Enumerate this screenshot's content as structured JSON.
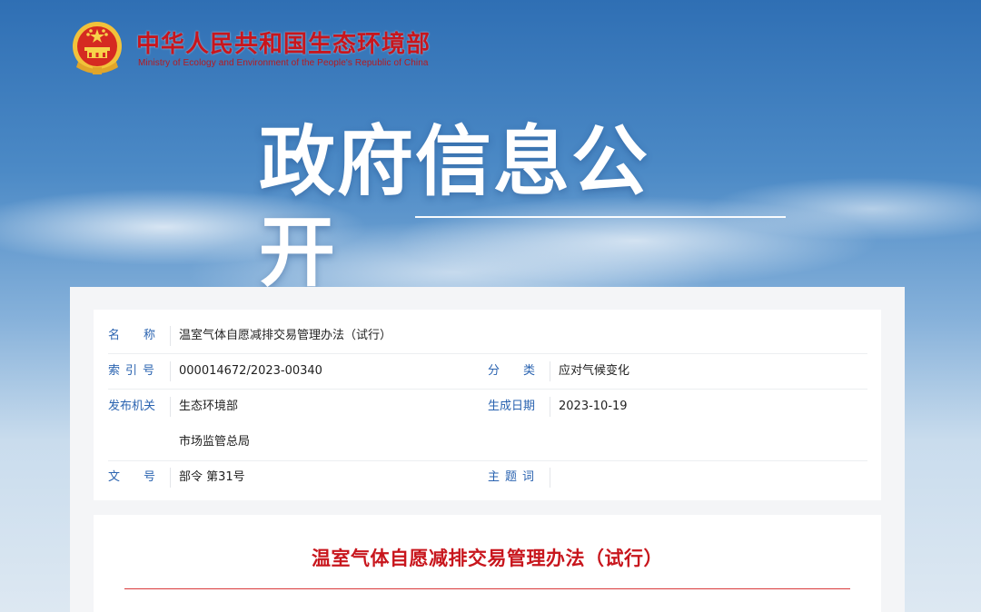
{
  "site": {
    "name": "中华人民共和国生态环境部",
    "name_en": "Ministry of Ecology and Environment of the People's Republic of China"
  },
  "hero": {
    "title": "政府信息公开"
  },
  "info": {
    "name_label": "名　　称",
    "name_value": "温室气体自愿减排交易管理办法（试行）",
    "index_label": "索引号",
    "index_value": "000014672/2023-00340",
    "category_label": "分　　类",
    "category_value": "应对气候变化",
    "publisher_label": "发布机关",
    "publisher_value_1": "生态环境部",
    "publisher_value_2": "市场监管总局",
    "date_label": "生成日期",
    "date_value": "2023-10-19",
    "docno_label": "文　　号",
    "docno_value": "部令 第31号",
    "keywords_label": "主题词",
    "keywords_value": ""
  },
  "article": {
    "title": "温室气体自愿减排交易管理办法（试行）"
  },
  "colors": {
    "brand_red": "#c8161d",
    "label_blue": "#2a63b0"
  },
  "icons": {
    "emblem": "national-emblem-icon"
  }
}
